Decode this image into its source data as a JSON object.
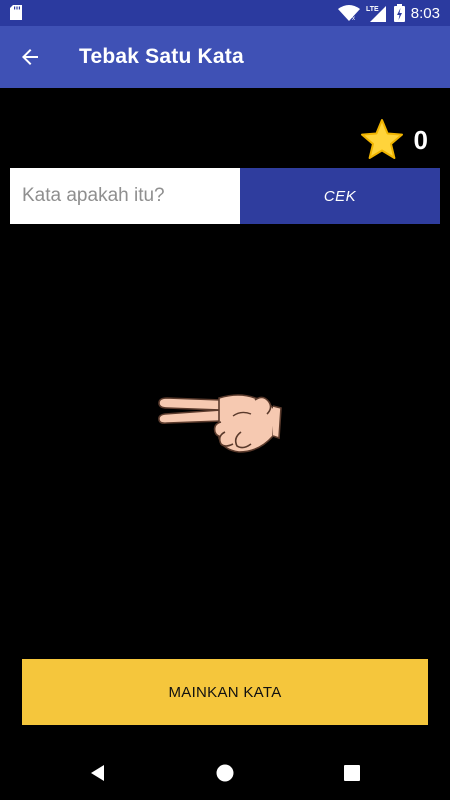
{
  "status_bar": {
    "time": "8:03",
    "network": "LTE",
    "icons": [
      "sd-card-icon",
      "wifi-icon",
      "signal-icon",
      "battery-charging-icon"
    ]
  },
  "app_bar": {
    "title": "Tebak Satu Kata",
    "back_icon": "arrow-back-icon"
  },
  "score": {
    "icon": "star-icon",
    "value": "0",
    "star_color": "#FFD43B"
  },
  "answer": {
    "placeholder": "Kata apakah itu?",
    "value": "",
    "submit_label": "CEK"
  },
  "clue": {
    "icon": "hand-sign-icon"
  },
  "play_button": {
    "label": "MAINKAN KATA"
  },
  "colors": {
    "app_bar": "#3F51B5",
    "status_bar": "#2B3A9F",
    "cek_button": "#2F3D9E",
    "play_button": "#F5C63C",
    "background": "#000000"
  },
  "nav_bar": {
    "icons": [
      "back-triangle-icon",
      "home-circle-icon",
      "recents-square-icon"
    ]
  }
}
